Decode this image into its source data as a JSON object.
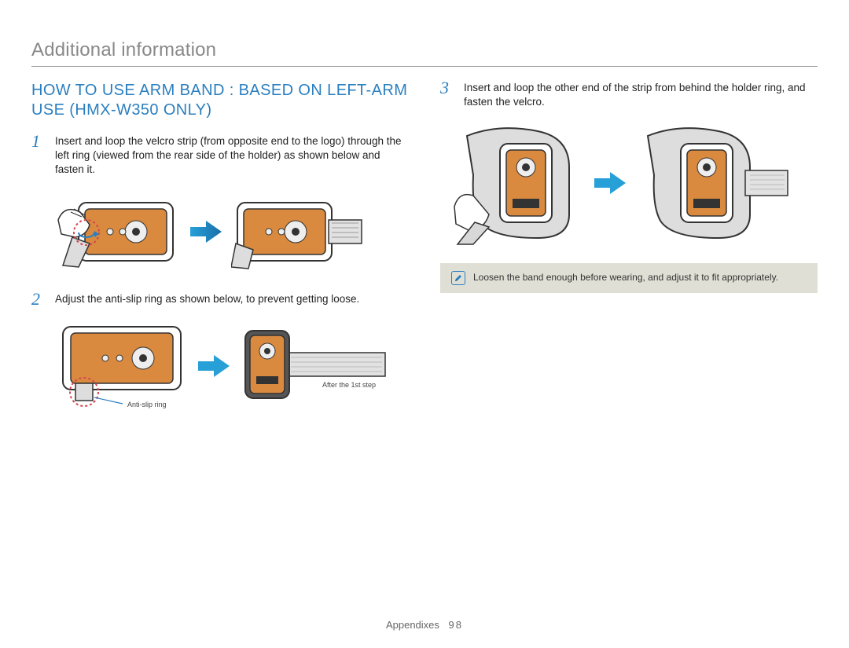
{
  "page": {
    "header": "Additional information",
    "footer_label": "Appendixes",
    "page_number": "98"
  },
  "left": {
    "heading": "HOW TO USE ARM BAND : BASED ON LEFT-ARM USE (HMX-W350 ONLY)",
    "steps": [
      {
        "num": "1",
        "text": "Insert and loop the velcro strip (from opposite end to the logo) through the left ring (viewed from the rear side of the holder) as shown below and fasten it."
      },
      {
        "num": "2",
        "text": "Adjust the anti-slip ring as shown below, to prevent getting loose."
      }
    ],
    "captions": {
      "anti_slip": "Anti-slip ring",
      "after_step": "After the 1st step"
    }
  },
  "right": {
    "steps": [
      {
        "num": "3",
        "text": "Insert and loop the other end of the strip from behind the holder ring, and fasten the velcro."
      }
    ],
    "callout": "Loosen the band enough before wearing, and adjust it to fit appropriately."
  },
  "icons": {
    "arrow": "arrow-right",
    "note": "pencil-note"
  },
  "colors": {
    "accent": "#2b7fbf",
    "device_orange": "#d98a3f",
    "callout_bg": "#dfdfd5",
    "highlight_red": "#d64550"
  }
}
